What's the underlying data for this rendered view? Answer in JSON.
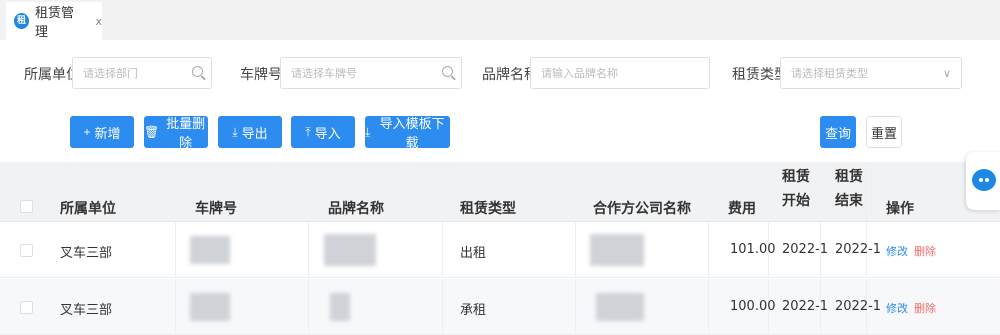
{
  "tab": {
    "icon": "rental-icon",
    "title": "租赁管理",
    "close": "x"
  },
  "filters": {
    "unit_label": "所属单位",
    "unit_placeholder": "请选择部门",
    "plate_label": "车牌号",
    "plate_placeholder": "请选择车牌号",
    "brand_label": "品牌名称",
    "brand_placeholder": "请输入品牌名称",
    "type_label": "租赁类型",
    "type_placeholder": "请选择租赁类型"
  },
  "toolbar": {
    "add": "新增",
    "add_icon": "+",
    "batch_delete": "批量删除",
    "export": "导出",
    "import": "导入",
    "template": "导入模板下载",
    "query": "查询",
    "reset": "重置"
  },
  "table": {
    "headers": {
      "unit": "所属单位",
      "plate": "车牌号",
      "brand": "品牌名称",
      "type": "租赁类型",
      "partner": "合作方公司名称",
      "fee": "费用",
      "start_1": "租赁",
      "start_2": "开始",
      "end_1": "租赁",
      "end_2": "结束",
      "ops": "操作"
    },
    "rows": [
      {
        "unit": "叉车三部",
        "type": "出租",
        "fee": "101.00",
        "start": "2022-1",
        "end": "2022-1",
        "edit": "修改",
        "delete": "删除"
      },
      {
        "unit": "叉车三部",
        "type": "承租",
        "fee": "100.00",
        "start": "2022-1",
        "end": "2022-1",
        "edit": "修改",
        "delete": "删除"
      }
    ]
  },
  "colors": {
    "primary": "#2d8cf0",
    "danger": "#f56c6c"
  }
}
